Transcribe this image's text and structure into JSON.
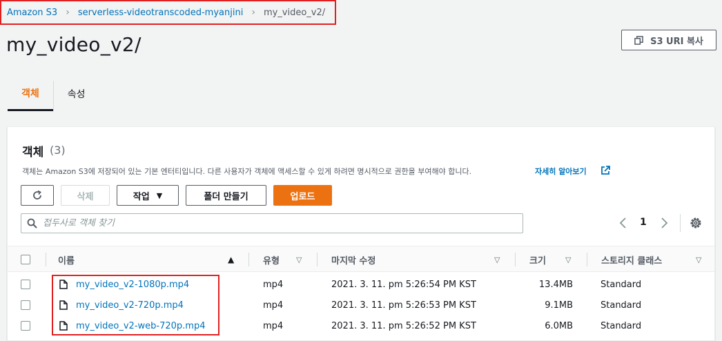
{
  "breadcrumb": {
    "root": "Amazon S3",
    "bucket": "serverless-videotranscoded-myanjini",
    "current": "my_video_v2/"
  },
  "page": {
    "title": "my_video_v2/",
    "copy_uri_label": "S3 URI 복사"
  },
  "tabs": [
    {
      "label": "객체",
      "active": true
    },
    {
      "label": "속성",
      "active": false
    }
  ],
  "objects": {
    "title": "객체",
    "count": "(3)",
    "description": "객체는 Amazon S3에 저장되어 있는 기본 엔터티입니다. 다른 사용자가 객체에 액세스할 수 있게 하려면 명시적으로 권한을 부여해야 합니다.",
    "learn_more": "자세히 알아보기",
    "buttons": {
      "delete": "삭제",
      "actions": "작업",
      "create_folder": "폴더 만들기",
      "upload": "업로드"
    },
    "search_placeholder": "접두사로 객체 찾기",
    "page_number": "1",
    "columns": {
      "name": "이름",
      "type": "유형",
      "modified": "마지막 수정",
      "size": "크기",
      "storage_class": "스토리지 클래스"
    },
    "rows": [
      {
        "name": "my_video_v2-1080p.mp4",
        "type": "mp4",
        "modified": "2021. 3. 11. pm 5:26:54 PM KST",
        "size": "13.4MB",
        "storage_class": "Standard"
      },
      {
        "name": "my_video_v2-720p.mp4",
        "type": "mp4",
        "modified": "2021. 3. 11. pm 5:26:53 PM KST",
        "size": "9.1MB",
        "storage_class": "Standard"
      },
      {
        "name": "my_video_v2-web-720p.mp4",
        "type": "mp4",
        "modified": "2021. 3. 11. pm 5:26:52 PM KST",
        "size": "6.0MB",
        "storage_class": "Standard"
      }
    ]
  },
  "colors": {
    "accent": "#ec7211",
    "link": "#0073bb",
    "annotation": "#e02020"
  }
}
